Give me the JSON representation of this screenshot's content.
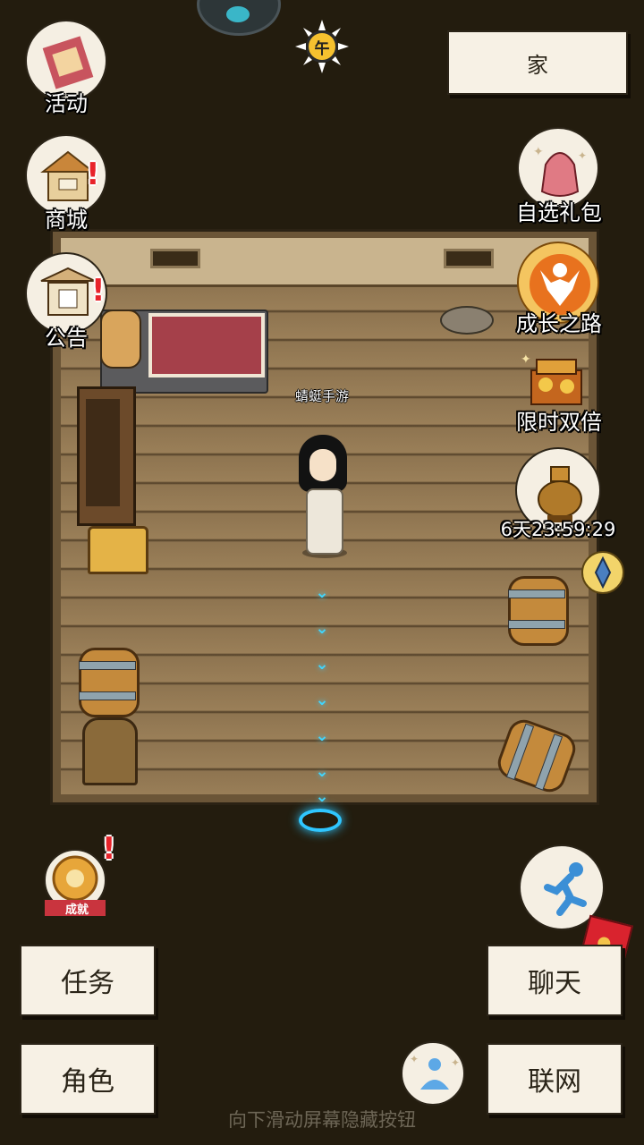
{
  "top_right_button": "家",
  "time_of_day": "午",
  "left_menu": [
    {
      "label": "活动",
      "icon": "scroll-icon",
      "alert": false
    },
    {
      "label": "商城",
      "icon": "shop-icon",
      "alert": true
    },
    {
      "label": "公告",
      "icon": "notice-board-icon",
      "alert": true
    }
  ],
  "right_menu": [
    {
      "label": "自选礼包",
      "icon": "gift-bag-icon"
    },
    {
      "label": "成长之路",
      "icon": "growth-icon"
    },
    {
      "label": "限时双倍",
      "icon": "treasure-chest-icon"
    },
    {
      "label": "6天23:59:29",
      "icon": "incense-burner-icon"
    }
  ],
  "player_name": "蜻蜓手游",
  "achievement": {
    "label": "成就",
    "alert": true
  },
  "buttons": {
    "tasks": "任务",
    "character": "角色",
    "chat": "聊天",
    "network": "联网"
  },
  "hint_text": "向下滑动屏幕隐藏按钮",
  "colors": {
    "background": "#231c0e",
    "paper": "#f7f1e5",
    "alert": "#e8232a",
    "path_arrow": "#40d6ff"
  }
}
